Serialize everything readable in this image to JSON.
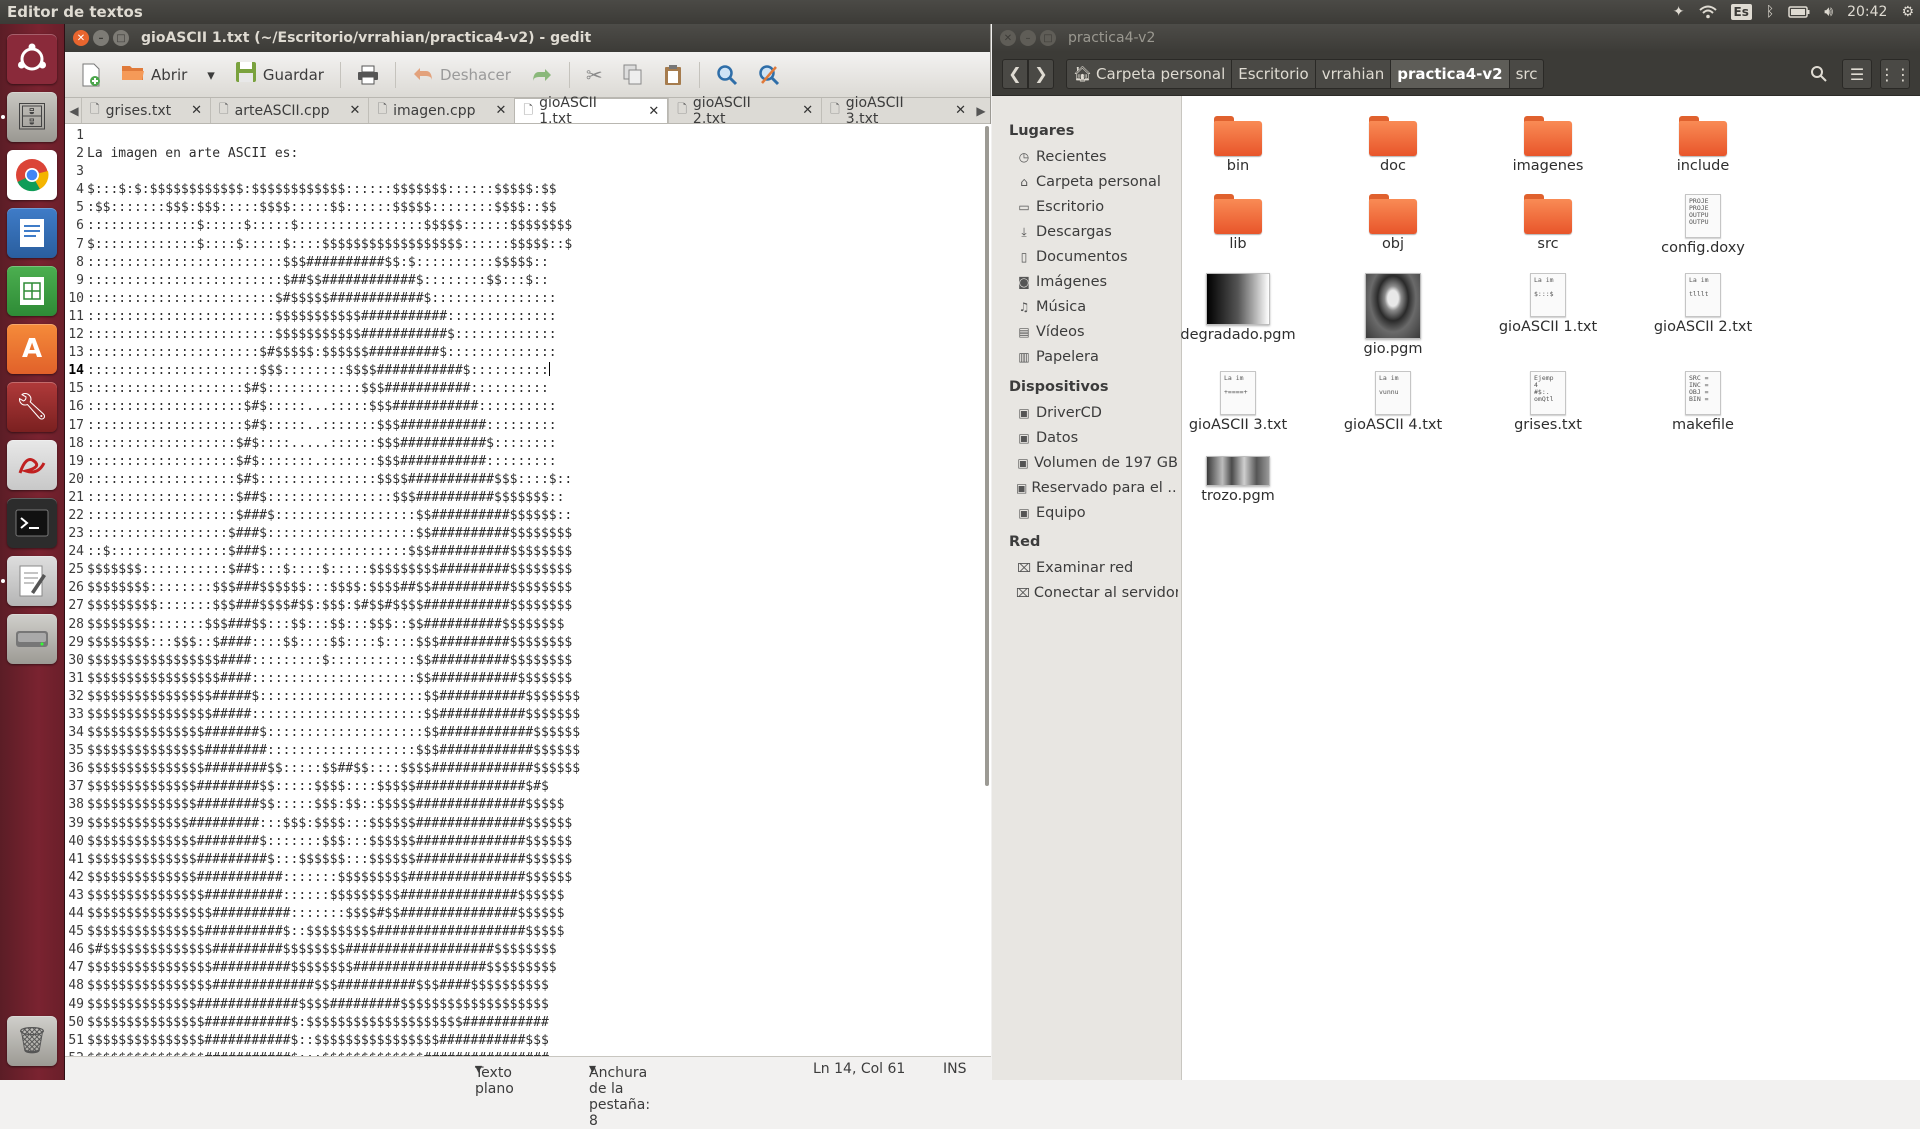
{
  "top_panel": {
    "app_title": "Editor de textos",
    "keyboard_layout": "Es",
    "clock": "20:42"
  },
  "gedit": {
    "window_title": "gioASCII 1.txt (~/Escritorio/vrrahian/practica4-v2) - gedit",
    "toolbar": {
      "open_label": "Abrir",
      "save_label": "Guardar",
      "undo_label": "Deshacer"
    },
    "tabs": [
      {
        "label": "grises.txt"
      },
      {
        "label": "arteASCII.cpp"
      },
      {
        "label": "imagen.cpp"
      },
      {
        "label": "gioASCII 1.txt"
      },
      {
        "label": "gioASCII 2.txt"
      },
      {
        "label": "gioASCII 3.txt"
      }
    ],
    "active_tab": 3,
    "current_line": 14,
    "lines": [
      "",
      "La imagen en arte ASCII es:",
      "",
      "$:::$:$:$$$$$$$$$$$$:$$$$$$$$$$$$::::::$$$$$$$::::::$$$$$:$$",
      ":$$:::::::$$$:$$$:::::$$$$:::::$$::::::$$$$$::::::::$$$$::$$",
      "::::::::::::::$:::::$:::::$::::::::::::::::$$$$$::::::$$$$$$$$",
      "$:::::::::::::$::::$:::::$::::$$$$$$$$$$$$$$$$$$::::::$$$$$::$",
      ":::::::::::::::::::::::::$$$##########$$:$::::::::::$$$$$::",
      ":::::::::::::::::::::::::$##$$############$::::::::$$:::$::",
      "::::::::::::::::::::::::$#$$$$$############$::::::::::::::::",
      "::::::::::::::::::::::::$$$$$$$$$$$###########::::::::::::::",
      "::::::::::::::::::::::::$$$$$$$$$$$###########$:::::::::::::",
      "::::::::::::::::::::::$#$$$$$:$$$$$$#########$::::::::::::::",
      "::::::::::::::::::::::$$$::::::::$$$$###########$::::::::::",
      "::::::::::::::::::::$#$::::::::::::$$$###########::::::::::",
      "::::::::::::::::::::$#$:::::...:::::$$$###########::::::::::",
      "::::::::::::::::::::$#$:::::..:::::::$$$###########:::::::::",
      ":::::::::::::::::::$#$::::.....::::::$$$###########$::::::::",
      ":::::::::::::::::::$#$:::::::.:::::::$$$###########:::::::::",
      ":::::::::::::::::::$#$:::::::::::::::$$$$###########$$$::::$::",
      ":::::::::::::::::::$##$::::::::::::::::$$$##########$$$$$$$::",
      ":::::::::::::::::::$###$::::::::::::::::::$$##########$$$$$$::",
      "::::::::::::::::::$###$:::::::::::::::::::$$##########$$$$$$$$",
      "::$:::::::::::::::$###$::::::::::::::::::$$$##########$$$$$$$$",
      "$$$$$$$:::::::::::$##$:::$::::$:::::$$$$$$$$$#########$$$$$$$$",
      "$$$$$$$$::::::::$$$###$$$$$$:::$$$$:$$$$##$$##########$$$$$$$$",
      "$$$$$$$$$:::::::$$$###$$$$#$$:$$$:$#$$#$$$$###########$$$$$$$$",
      "$$$$$$$$:::::::$$$###$$:::$$:::$$:::$$$::$$##########$$$$$$$$",
      "$$$$$$$$:::$$$::$####::::$$::::$$::::$::::$$$#########$$$$$$$$",
      "$$$$$$$$$$$$$$$$$####:::::::::$:::::::::::$$##########$$$$$$$$",
      "$$$$$$$$$$$$$$$$$####:::::::::::::::::::::$$###########$$$$$$$",
      "$$$$$$$$$$$$$$$$#####$:::::::::::::::::::::$$###########$$$$$$$",
      "$$$$$$$$$$$$$$$$#####::::::::::::::::::::::$$###########$$$$$$$",
      "$$$$$$$$$$$$$$$#######$::::::::::::::::::::$$############$$$$$$",
      "$$$$$$$$$$$$$$$########:::::::::::::::::::$$$############$$$$$$",
      "$$$$$$$$$$$$$$$########$$:::::$$##$$::::$$$$#############$$$$$$",
      "$$$$$$$$$$$$$$########$$:::::$$$$::::$$$$$##############$#$",
      "$$$$$$$$$$$$$$########$$:::::$$$:$$::$$$$$##############$$$$$",
      "$$$$$$$$$$$$$#########:::$$$:$$$$:::$$$$$$##############$$$$$$",
      "$$$$$$$$$$$$$$########$:::::::$$$:::$$$$$$##############$$$$$$",
      "$$$$$$$$$$$$$$#########$:::$$$$$$:::$$$$$$##############$$$$$$",
      "$$$$$$$$$$$$$$###########:::::::$$$$$$$$$###############$$$$$$",
      "$$$$$$$$$$$$$$$##########::::::$$$$$$$$$###############$$$$$$",
      "$$$$$$$$$$$$$$$$##########:::::::$$$$#$$###############$$$$$$",
      "$$$$$$$$$$$$$$$##########$::$$$$$$$$$###################$$$$$",
      "$#$$$$$$$$$$$$$$#########$$$$$$$$###################$$$$$$$$",
      "$$$$$$$$$$$$$$$$##########$$$$$$$$#################$$$$$$$$$",
      "$$$$$$$$$$$$$$$$#############$$$##########$$$####$$$$$$$$$$",
      "$$$$$$$$$$$$$$#############$$$$#########$$$$$$$$$$$$$$$$$$$",
      "$$$$$$$$$$$$$$$###########$:$$$$$$$$$$$$$$$$$$$$###########",
      "$$$$$$$$$$$$$$$###########$::$$$$$$$$$$$$$$$$###########$$$",
      "$$$$$$$$$$$$$$$###########$:::$$$$$$$$$$$$$################"
    ],
    "status": {
      "language": "Texto plano",
      "tab_width": "Anchura de la pestaña: 8",
      "position": "Ln 14, Col 61",
      "mode": "INS"
    }
  },
  "nautilus": {
    "window_title": "practica4-v2",
    "breadcrumbs": [
      {
        "label": "Carpeta personal",
        "icon": "home-icon"
      },
      {
        "label": "Escritorio"
      },
      {
        "label": "vrrahian"
      },
      {
        "label": "practica4-v2"
      },
      {
        "label": "src"
      }
    ],
    "current_crumb": 3,
    "sidebar": {
      "places_heading": "Lugares",
      "places": [
        {
          "label": "Recientes",
          "icon": "clock-icon"
        },
        {
          "label": "Carpeta personal",
          "icon": "home-icon"
        },
        {
          "label": "Escritorio",
          "icon": "desktop-icon"
        },
        {
          "label": "Descargas",
          "icon": "download-icon"
        },
        {
          "label": "Documentos",
          "icon": "document-icon"
        },
        {
          "label": "Imágenes",
          "icon": "camera-icon"
        },
        {
          "label": "Música",
          "icon": "music-icon"
        },
        {
          "label": "Vídeos",
          "icon": "film-icon"
        },
        {
          "label": "Papelera",
          "icon": "trash-icon"
        }
      ],
      "devices_heading": "Dispositivos",
      "devices": [
        {
          "label": "DriverCD",
          "icon": "drive-icon"
        },
        {
          "label": "Datos",
          "icon": "drive-icon"
        },
        {
          "label": "Volumen de 197 GB",
          "icon": "drive-icon"
        },
        {
          "label": "Reservado para el ...",
          "icon": "drive-icon"
        },
        {
          "label": "Equipo",
          "icon": "computer-icon"
        }
      ],
      "network_heading": "Red",
      "network": [
        {
          "label": "Examinar red",
          "icon": "network-icon"
        },
        {
          "label": "Conectar al servidor",
          "icon": "server-icon"
        }
      ]
    },
    "files": [
      {
        "name": "bin",
        "kind": "folder"
      },
      {
        "name": "doc",
        "kind": "folder"
      },
      {
        "name": "imagenes",
        "kind": "folder"
      },
      {
        "name": "include",
        "kind": "folder"
      },
      {
        "name": "lib",
        "kind": "folder"
      },
      {
        "name": "obj",
        "kind": "folder"
      },
      {
        "name": "src",
        "kind": "folder"
      },
      {
        "name": "config.doxy",
        "kind": "text",
        "preview": "PROJE\nPROJE\nOUTPU\nOUTPU"
      },
      {
        "name": "degradado.pgm",
        "kind": "image"
      },
      {
        "name": "gio.pgm",
        "kind": "image"
      },
      {
        "name": "gioASCII 1.txt",
        "kind": "text",
        "preview": "La im\n\n$:::$"
      },
      {
        "name": "gioASCII 2.txt",
        "kind": "text",
        "preview": "La im\n\ntlllt"
      },
      {
        "name": "gioASCII 3.txt",
        "kind": "text",
        "preview": "La im\n\n+====+"
      },
      {
        "name": "gioASCII 4.txt",
        "kind": "text",
        "preview": "La im\n\nvunnu"
      },
      {
        "name": "grises.txt",
        "kind": "text",
        "preview": "Ejemp\n4\n#$:.\nomQtl"
      },
      {
        "name": "makefile",
        "kind": "text",
        "preview": "SRC =\nINC =\nOBJ =\nBIN ="
      },
      {
        "name": "trozo.pgm",
        "kind": "image"
      }
    ]
  }
}
